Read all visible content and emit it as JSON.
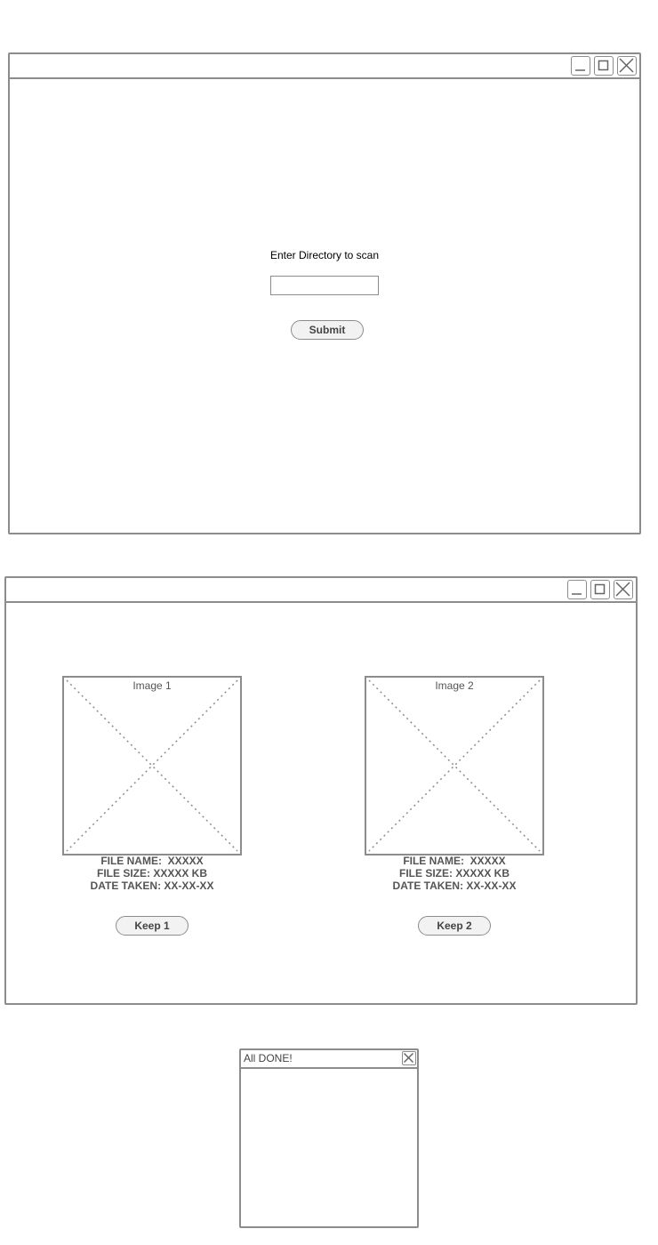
{
  "scan_window": {
    "prompt": "Enter Directory to scan",
    "directory_input": {
      "value": "",
      "placeholder": ""
    },
    "submit_label": "Submit",
    "controls": [
      "minimize-icon",
      "maximize-icon",
      "close-icon"
    ]
  },
  "compare_window": {
    "controls": [
      "minimize-icon",
      "maximize-icon",
      "close-icon"
    ],
    "images": [
      {
        "placeholder_label": "Image 1",
        "file_name": "FILE NAME:  XXXXX",
        "file_size": "FILE SIZE: XXXXX KB",
        "date_taken": "DATE TAKEN: XX-XX-XX",
        "keep_label": "Keep 1"
      },
      {
        "placeholder_label": "Image 2",
        "file_name": "FILE NAME:  XXXXX",
        "file_size": "FILE SIZE: XXXXX KB",
        "date_taken": "DATE TAKEN: XX-XX-XX",
        "keep_label": "Keep 2"
      }
    ]
  },
  "done_window": {
    "title": "All DONE!",
    "controls": [
      "close-icon"
    ]
  },
  "colors": {
    "border": "#8c8c8c",
    "button_fill": "#f2f2f2",
    "text": "#555555"
  }
}
